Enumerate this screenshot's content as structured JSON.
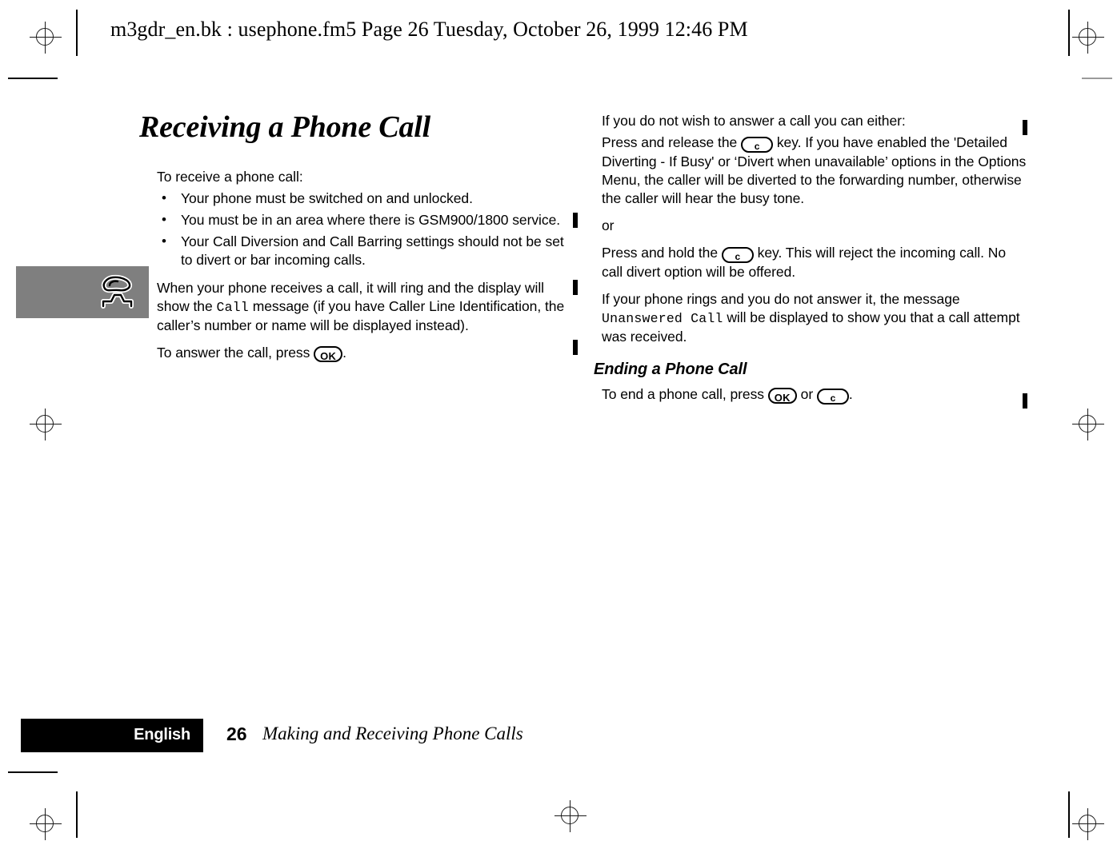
{
  "header": {
    "text": "m3gdr_en.bk : usephone.fm5  Page 26  Tuesday, October 26, 1999  12:46 PM"
  },
  "left_column": {
    "chapter_title": "Receiving a Phone Call",
    "intro": "To receive a phone call:",
    "bullets": [
      "Your phone must be switched on and unlocked.",
      "You must be in an area where there is GSM900/1800 service.",
      "Your Call Diversion and Call Barring settings should not be set to divert or bar incoming calls."
    ],
    "para_receive_pre": "When your phone receives a call, it will ring and the display will show the ",
    "para_receive_lcd": "Call",
    "para_receive_post": " message (if you have Caller Line Identification, the caller’s number or name will be displayed instead).",
    "para_answer_pre": "To answer the call, press ",
    "para_answer_key": "OK",
    "para_answer_post": "."
  },
  "right_column": {
    "intro": "If you do not wish to answer a call you can either:",
    "option_one_pre": "Press and release the ",
    "option_one_key": "c",
    "option_one_post": " key. If you have enabled the 'Detailed Diverting - If Busy' or ‘Divert when unavailable’ options in the Options Menu, the caller will be diverted to the forwarding number, otherwise the caller will hear the busy tone.",
    "or_label": "or",
    "option_two_pre": "Press and hold the ",
    "option_two_key": "c",
    "option_two_post": " key. This will reject the incoming call. No call divert option will be offered.",
    "unanswered_pre": "If your phone rings and you do not answer it, the message ",
    "unanswered_lcd": "Unanswered Call",
    "unanswered_post": " will be displayed to show you that a call attempt was received.",
    "section_title": "Ending a Phone Call",
    "end_call_pre": "To end a phone call, press ",
    "end_call_key_ok": "OK",
    "end_call_mid": " or ",
    "end_call_key_c": "c",
    "end_call_post": "."
  },
  "margin_icon": {
    "name": "phone-handset-on-cradle-icon",
    "background_color": "#7f7f7f"
  },
  "footer": {
    "language": "English",
    "page_number": "26",
    "section": "Making and Receiving Phone Calls"
  }
}
